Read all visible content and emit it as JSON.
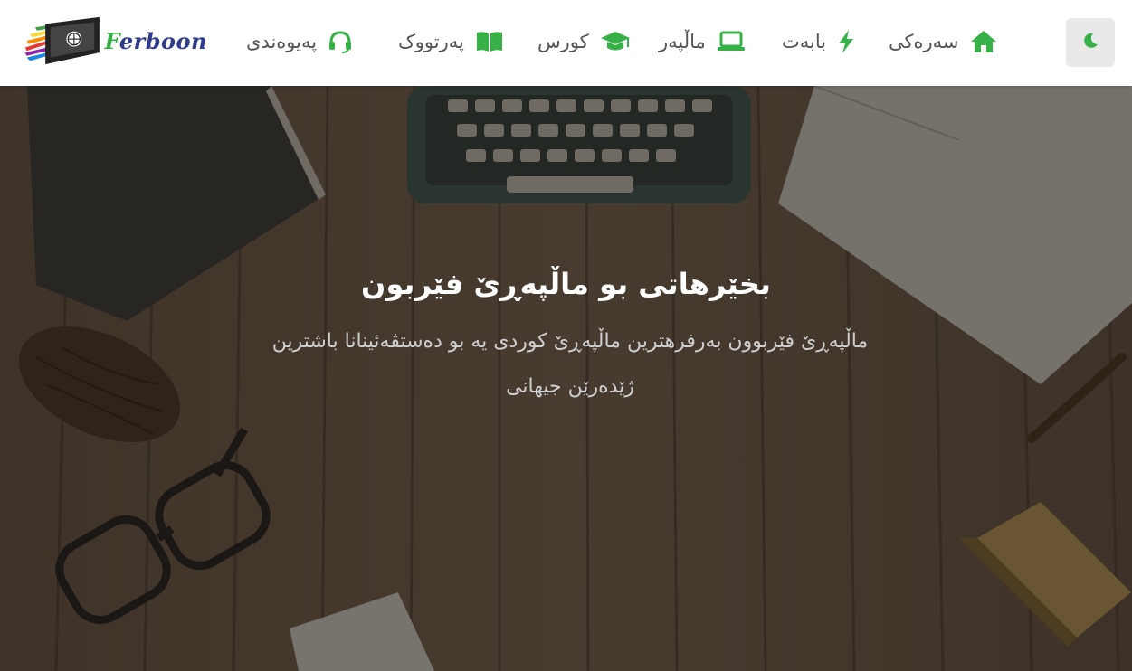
{
  "brand": {
    "logo_text_first": "F",
    "logo_text_rest": "erboon",
    "accent_color": "#38b048"
  },
  "nav": {
    "items": [
      {
        "id": "home",
        "label": "سەرەکی",
        "icon": "home-icon"
      },
      {
        "id": "topics",
        "label": "بابەت",
        "icon": "bolt-icon"
      },
      {
        "id": "websites",
        "label": "ماڵپەر",
        "icon": "laptop-icon"
      },
      {
        "id": "courses",
        "label": "کورس",
        "icon": "graduation-cap-icon"
      },
      {
        "id": "books",
        "label": "پەرتووک",
        "icon": "book-icon"
      },
      {
        "id": "contact",
        "label": "پەیوەندی",
        "icon": "headset-icon"
      }
    ]
  },
  "theme_toggle": {
    "icon": "moon-icon"
  },
  "hero": {
    "title": "بخێرهاتی بو ماڵپەڕێ فێربون",
    "subtitle": "ماڵپەڕێ فێربوون بەرفرهترین ماڵپەڕێ کوردی یە بو دەستڤەئینانا باشترین ژێدەرێن جیهانی"
  }
}
